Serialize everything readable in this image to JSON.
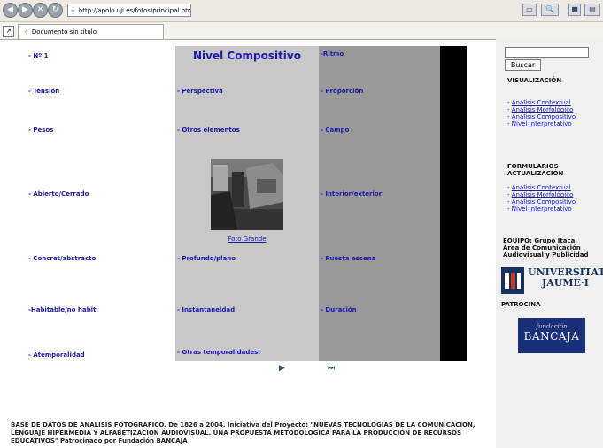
{
  "browser": {
    "url": "http://apolo.uji.es/fotos/principal.htm",
    "url_prefix": "⟡",
    "tab_title": "Documento sin título",
    "tab_prefix": "⟡"
  },
  "main": {
    "title": "Nivel Compositivo",
    "col1": [
      {
        "label": "- Nº 1"
      },
      {
        "label": "- Tensión"
      },
      {
        "label": "- Pesos"
      },
      {
        "label": "- Abierto/Cerrado"
      },
      {
        "label": "- Concret/abstracto"
      },
      {
        "label": "-Habitable/no habit."
      },
      {
        "label": "- Atemporalidad"
      }
    ],
    "col2": [
      {
        "label": "- Perspectiva"
      },
      {
        "label": "- Otros elementos"
      },
      {
        "label": "- Profundo/plano"
      },
      {
        "label": "- Instantaneidad"
      },
      {
        "label": "- Otras temporalidades:"
      }
    ],
    "col3": [
      {
        "label": "-Ritmo"
      },
      {
        "label": "- Proporción"
      },
      {
        "label": "- Campo"
      },
      {
        "label": "- Interior/exterior"
      },
      {
        "label": "- Puesta escena"
      },
      {
        "label": "- Duración"
      }
    ],
    "photo_link": "Foto Grande",
    "nav_next_icon": "play-icon",
    "nav_last_icon": "fast-forward-icon"
  },
  "sidebar": {
    "search_button": "Buscar",
    "visualizacion": {
      "heading": "VISUALIZACIÓN",
      "links": [
        "Análisis Contextual",
        "Análisis Morfológico",
        "Análisis Compositivo",
        "Nivel Interpretativo"
      ]
    },
    "formularios": {
      "heading_line1": "FORMULARIOS",
      "heading_line2": "ACTUALIZACIÓN",
      "links": [
        "Análisis Contextual",
        "Análisis Morfológico",
        "Análisis Compositivo",
        "Nivel Interpretativo"
      ]
    },
    "equipo": [
      "EQUIPO: Grupo Itaca.",
      "Área de Comunicación",
      "Audiovisual y Publicidad"
    ],
    "uji_line1": "UNIVERSITAT",
    "uji_line2": "JAUME·I",
    "patrocina": "PATROCINA",
    "bancaja_small": "fundación",
    "bancaja_big": "BANCAJA"
  },
  "footer": {
    "line1": "BASE DE DATOS DE ANÁLISIS FOTOGRÁFICO. De 1826 a 2004. Iniciativa del Proyecto: \"NUEVAS TECNOLOGIAS DE LA COMUNICACION,",
    "line2": "LENGUAJE HIPERMEDIA Y ALFABETIZACION AUDIOVISUAL. UNA PROPUESTA METODOLOGICA PARA LA PRODUCCION DE RECURSOS",
    "line3": "EDUCATIVOS\" Patrocinado por Fundación BANCAJA"
  },
  "colors": {
    "label_blue": "#1a1aae",
    "col2_gray": "#c8c8c8",
    "col3_gray": "#999999"
  }
}
